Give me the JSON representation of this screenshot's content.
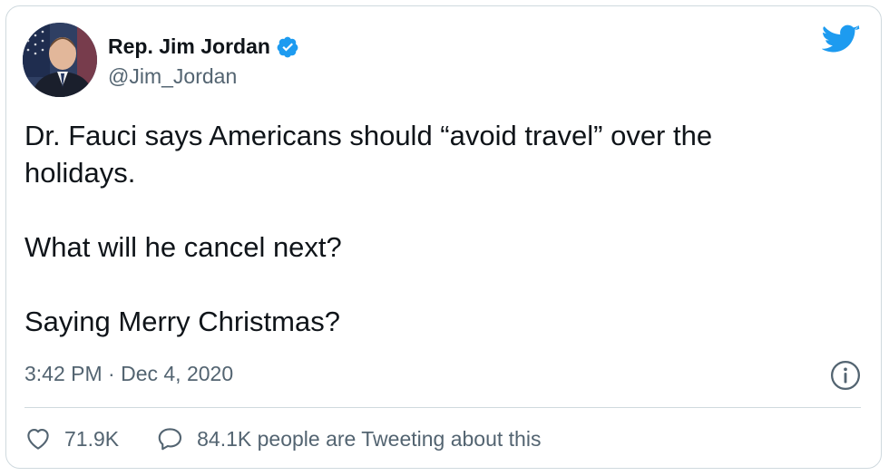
{
  "author": {
    "name": "Rep. Jim Jordan",
    "handle": "@Jim_Jordan",
    "verified": true
  },
  "tweet": {
    "text": "Dr. Fauci says Americans should “avoid travel” over the\nholidays.\n\nWhat will he cancel next?\n\nSaying Merry Christmas?",
    "timestamp": "3:42 PM · Dec 4, 2020"
  },
  "actions": {
    "likes": "71.9K",
    "conversation": "84.1K people are Tweeting about this"
  },
  "colors": {
    "twitter_blue": "#1d9bf0",
    "text_primary": "#0f1419",
    "text_secondary": "#536471",
    "border": "#cfd9de"
  },
  "icons": {
    "verified": "verified-badge-icon",
    "brand": "twitter-bird-icon",
    "info": "info-icon",
    "like": "heart-icon",
    "reply": "speech-bubble-icon"
  }
}
